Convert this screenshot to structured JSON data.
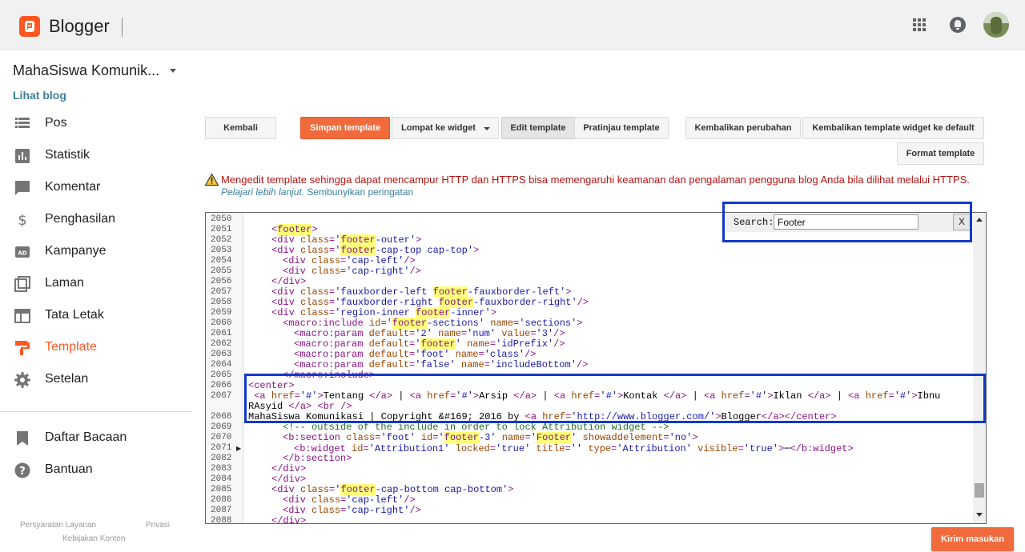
{
  "header": {
    "brand": "Blogger",
    "icons": [
      "apps-icon",
      "notifications-icon",
      "avatar"
    ]
  },
  "sidebar": {
    "blog_title": "MahaSiswa Komunik...",
    "view_blog": "Lihat blog",
    "items": [
      {
        "label": "Pos",
        "icon": "posts-icon"
      },
      {
        "label": "Statistik",
        "icon": "stats-icon"
      },
      {
        "label": "Komentar",
        "icon": "comments-icon"
      },
      {
        "label": "Penghasilan",
        "icon": "dollar-icon"
      },
      {
        "label": "Kampanye",
        "icon": "ads-icon"
      },
      {
        "label": "Laman",
        "icon": "pages-icon"
      },
      {
        "label": "Tata Letak",
        "icon": "layout-icon"
      },
      {
        "label": "Template",
        "icon": "paint-roller-icon",
        "active": true
      },
      {
        "label": "Setelan",
        "icon": "gear-icon"
      }
    ],
    "secondary": [
      {
        "label": "Daftar Bacaan",
        "icon": "bookmark-icon"
      },
      {
        "label": "Bantuan",
        "icon": "help-icon"
      }
    ],
    "footer_links": [
      "Persyaratan Layanan",
      "Privasi",
      "Kebijakan Konten"
    ]
  },
  "toolbar": {
    "back": "Kembali",
    "save": "Simpan template",
    "jump": "Lompat ke widget",
    "edit": "Edit template",
    "preview": "Pratinjau template",
    "revert": "Kembalikan perubahan",
    "revert_widgets": "Kembalikan template widget ke default",
    "format": "Format template"
  },
  "warning": {
    "text": "Mengedit template sehingga dapat mencampur HTTP dan HTTPS bisa memengaruhi keamanan dan pengalaman pengguna blog Anda bila dilihat melalui HTTPS.",
    "learn_more": "Pelajari lebih lanjut.",
    "hide": "Sembunyikan peringatan"
  },
  "search": {
    "label": "Search:",
    "value": "Footer",
    "close": "X"
  },
  "feedback": "Kirim masukan",
  "editor": {
    "line_numbers": [
      "2050",
      "2051",
      "2052",
      "2053",
      "2054",
      "2055",
      "2056",
      "2057",
      "2058",
      "2059",
      "2060",
      "2061",
      "2062",
      "2063",
      "2064",
      "2065",
      "2066",
      "2067",
      "",
      "2068",
      "2069",
      "2070",
      "2071",
      "2082",
      "2083",
      "2084",
      "2085",
      "2086",
      "2087",
      "2088"
    ],
    "folded_lines": [
      "2071"
    ]
  },
  "colors": {
    "accent": "#ff5722",
    "primary_button": "#f06a3c",
    "link": "#3c7e9d",
    "warning": "#b31412",
    "highlight": "#ffff7a",
    "annotation_box": "#1238c8"
  }
}
